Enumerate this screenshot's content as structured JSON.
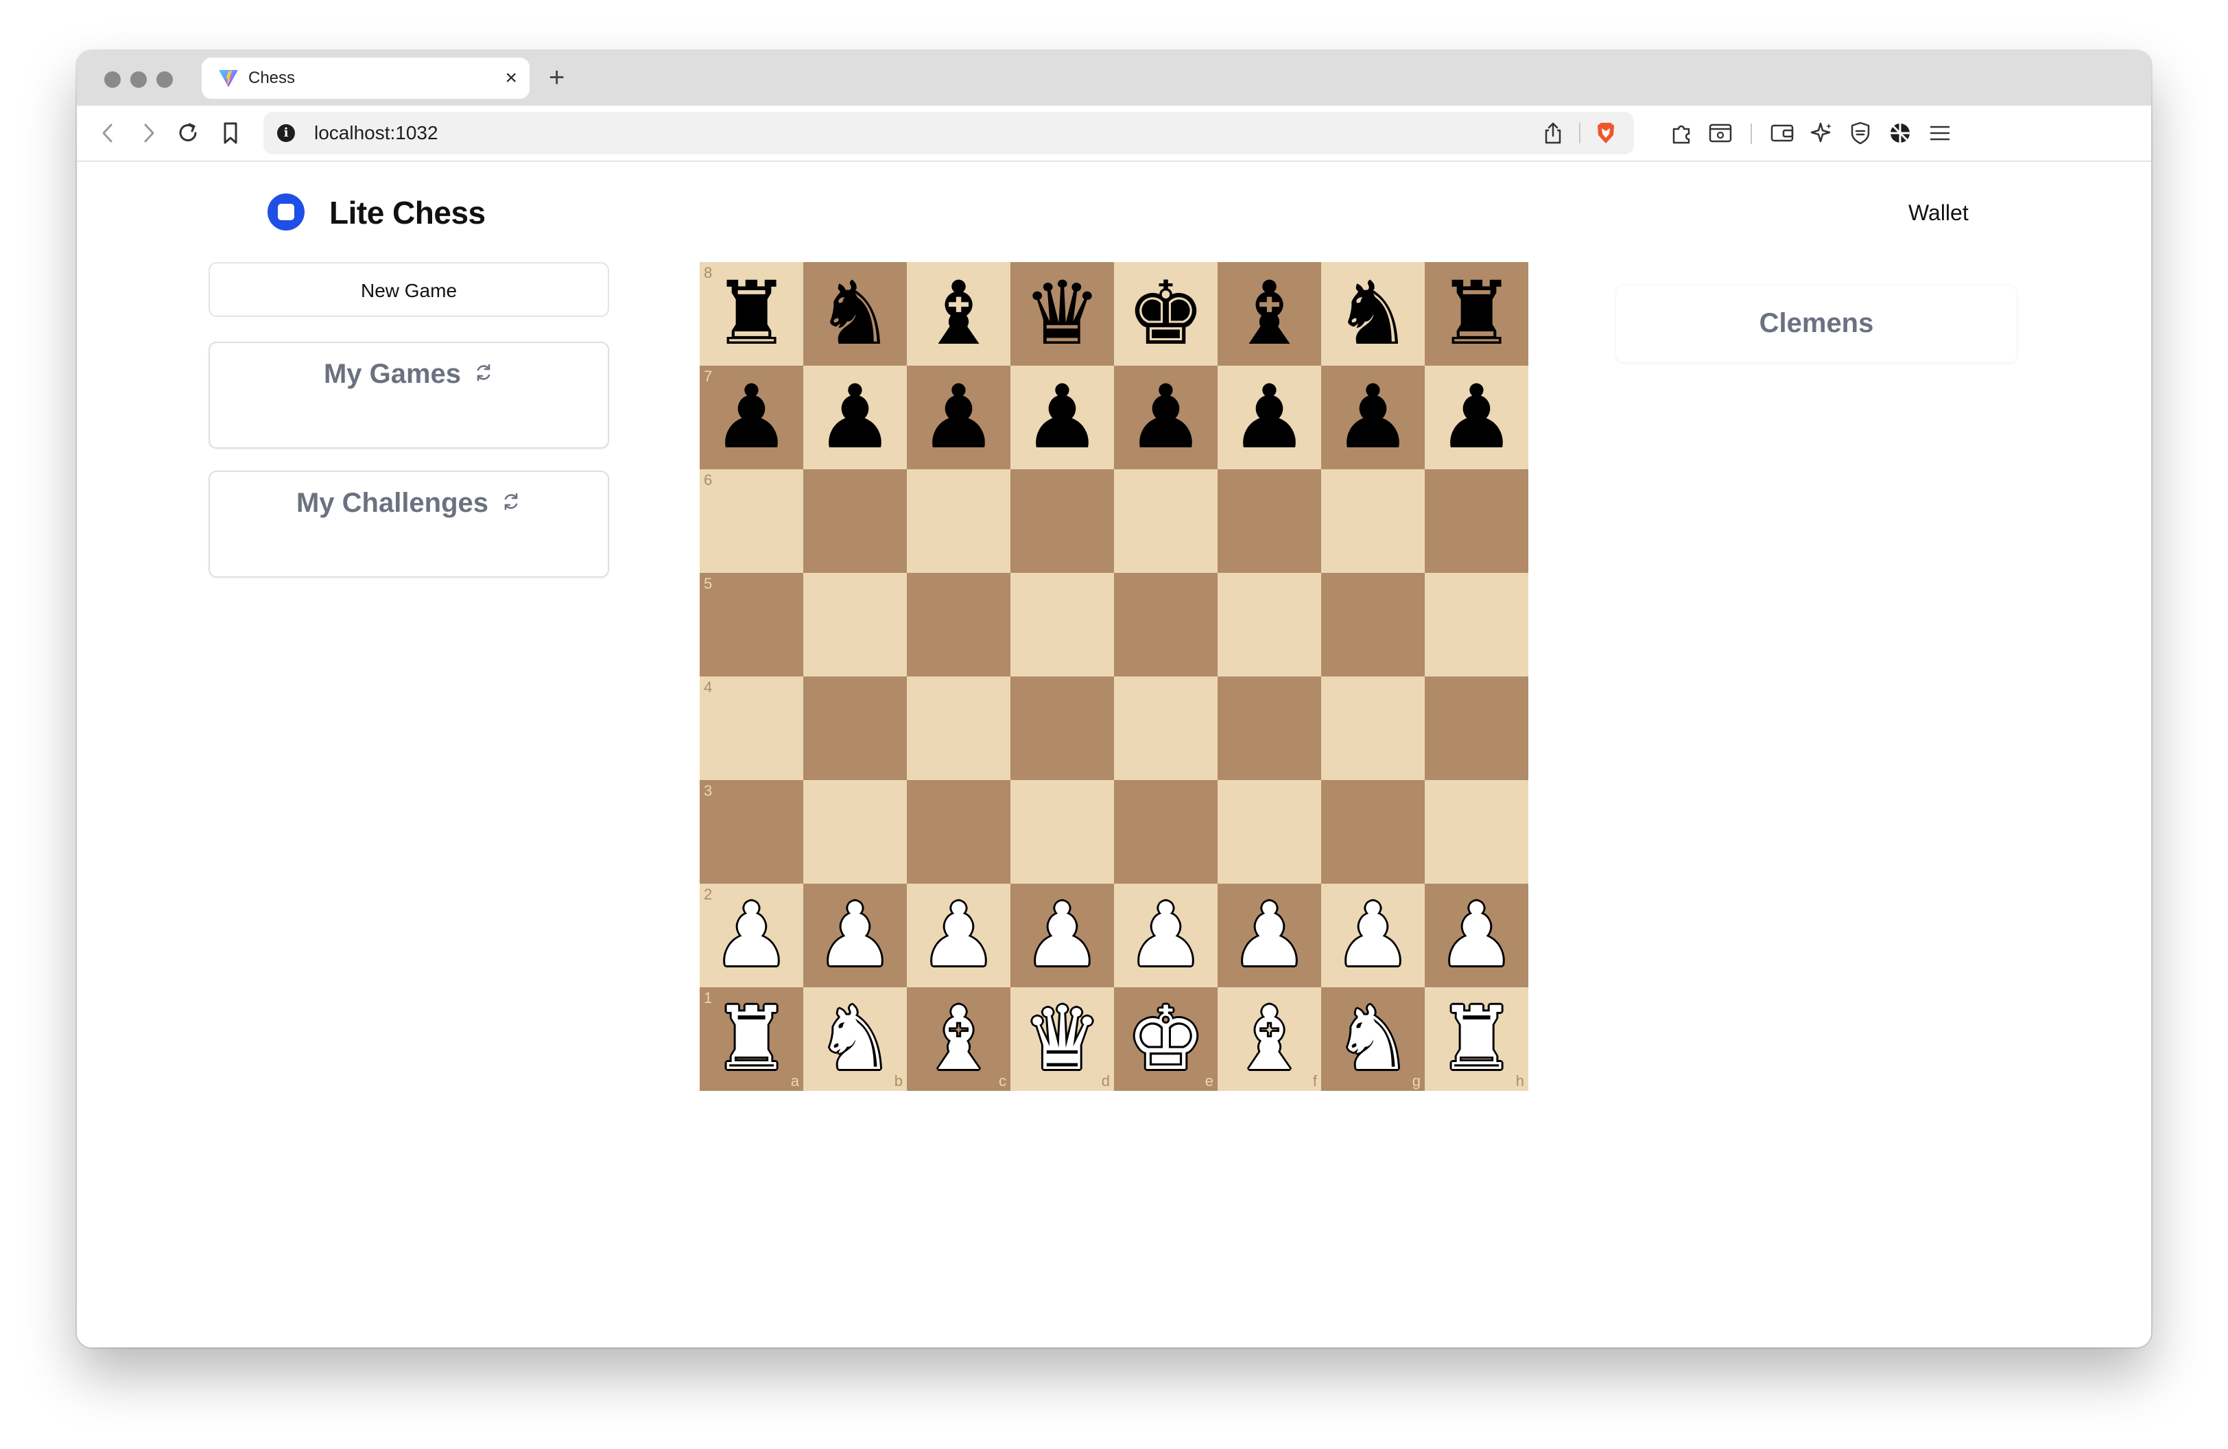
{
  "browser": {
    "tab_title": "Chess",
    "tab_close": "×",
    "new_tab": "+",
    "url": "localhost:1032",
    "info": "i"
  },
  "app": {
    "title": "Lite Chess",
    "logo_color": "#1f4fe6",
    "wallet_label": "Wallet",
    "new_game_label": "New Game",
    "my_games_label": "My Games",
    "my_challenges_label": "My Challenges",
    "player_name": "Clemens"
  },
  "board": {
    "light_color": "#ecd8b5",
    "dark_color": "#b18a67",
    "files": [
      "a",
      "b",
      "c",
      "d",
      "e",
      "f",
      "g",
      "h"
    ],
    "ranks": [
      "8",
      "7",
      "6",
      "5",
      "4",
      "3",
      "2",
      "1"
    ],
    "rows": [
      [
        "br",
        "bn",
        "bb",
        "bq",
        "bk",
        "bb",
        "bn",
        "br"
      ],
      [
        "bp",
        "bp",
        "bp",
        "bp",
        "bp",
        "bp",
        "bp",
        "bp"
      ],
      [
        "",
        "",
        "",
        "",
        "",
        "",
        "",
        ""
      ],
      [
        "",
        "",
        "",
        "",
        "",
        "",
        "",
        ""
      ],
      [
        "",
        "",
        "",
        "",
        "",
        "",
        "",
        ""
      ],
      [
        "",
        "",
        "",
        "",
        "",
        "",
        "",
        ""
      ],
      [
        "wp",
        "wp",
        "wp",
        "wp",
        "wp",
        "wp",
        "wp",
        "wp"
      ],
      [
        "wr",
        "wn",
        "wb",
        "wq",
        "wk",
        "wb",
        "wn",
        "wr"
      ]
    ]
  }
}
